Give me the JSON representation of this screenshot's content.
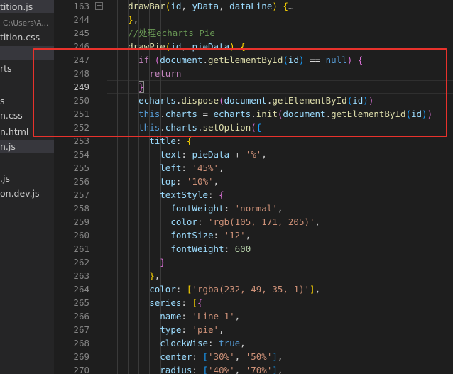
{
  "sidebar": {
    "files": [
      {
        "name": "tition.js",
        "active": true
      },
      {
        "name": "C:\\Users\\A...",
        "active": false,
        "sub": true
      },
      {
        "name": "tition.css",
        "active": false
      },
      {
        "name": "",
        "active": true
      },
      {
        "name": "rts",
        "active": false
      },
      {
        "name": "",
        "active": false
      },
      {
        "name": "s",
        "active": false
      },
      {
        "name": "n.css",
        "active": false
      },
      {
        "name": "n.html",
        "active": false
      },
      {
        "name": "n.js",
        "active": true
      },
      {
        "name": "",
        "active": false
      },
      {
        "name": ".js",
        "active": false
      },
      {
        "name": "on.dev.js",
        "active": false
      }
    ]
  },
  "gutter": {
    "line_numbers": [
      "163",
      "244",
      "245",
      "246",
      "247",
      "248",
      "249",
      "250",
      "251",
      "252",
      "253",
      "254",
      "255",
      "256",
      "257",
      "258",
      "259",
      "260",
      "261",
      "262",
      "263",
      "264",
      "265",
      "266",
      "267",
      "268",
      "269",
      "270"
    ],
    "current_line": "249",
    "fold_symbol": "+"
  },
  "code": {
    "lines": [
      {
        "indent": 2,
        "tokens": [
          [
            "fn",
            "drawBar"
          ],
          [
            "b1",
            "("
          ],
          [
            "vr",
            "id"
          ],
          [
            "pn",
            ", "
          ],
          [
            "vr",
            "yData"
          ],
          [
            "pn",
            ", "
          ],
          [
            "vr",
            "dataLine"
          ],
          [
            "b1",
            ")"
          ],
          [
            "pn",
            " "
          ],
          [
            "b1",
            "{"
          ],
          [
            "fold-dots",
            "…"
          ]
        ]
      },
      {
        "indent": 2,
        "tokens": [
          [
            "b1",
            "}"
          ],
          [
            "pn",
            ","
          ]
        ]
      },
      {
        "indent": 2,
        "tokens": [
          [
            "cm",
            "//处理echarts Pie"
          ]
        ]
      },
      {
        "indent": 2,
        "tokens": [
          [
            "fn",
            "drawPie"
          ],
          [
            "b1",
            "("
          ],
          [
            "vr",
            "id"
          ],
          [
            "pn",
            ", "
          ],
          [
            "vr",
            "pieData"
          ],
          [
            "b1",
            ")"
          ],
          [
            "pn",
            " "
          ],
          [
            "b1",
            "{"
          ]
        ]
      },
      {
        "indent": 3,
        "tokens": [
          [
            "kw",
            "if"
          ],
          [
            "pn",
            " "
          ],
          [
            "b2",
            "("
          ],
          [
            "vr",
            "document"
          ],
          [
            "pn",
            "."
          ],
          [
            "fn",
            "getElementById"
          ],
          [
            "b3",
            "("
          ],
          [
            "vr",
            "id"
          ],
          [
            "b3",
            ")"
          ],
          [
            "pn",
            " == "
          ],
          [
            "kb",
            "null"
          ],
          [
            "b2",
            ")"
          ],
          [
            "pn",
            " "
          ],
          [
            "b2",
            "{"
          ]
        ]
      },
      {
        "indent": 4,
        "tokens": [
          [
            "kw",
            "return"
          ]
        ]
      },
      {
        "indent": 3,
        "tokens": [
          [
            "b2",
            "}"
          ]
        ]
      },
      {
        "indent": 3,
        "tokens": [
          [
            "vr",
            "echarts"
          ],
          [
            "pn",
            "."
          ],
          [
            "fn",
            "dispose"
          ],
          [
            "b2",
            "("
          ],
          [
            "vr",
            "document"
          ],
          [
            "pn",
            "."
          ],
          [
            "fn",
            "getElementById"
          ],
          [
            "b3",
            "("
          ],
          [
            "vr",
            "id"
          ],
          [
            "b3",
            ")"
          ],
          [
            "b2",
            ")"
          ]
        ]
      },
      {
        "indent": 3,
        "tokens": [
          [
            "kb",
            "this"
          ],
          [
            "pn",
            "."
          ],
          [
            "vr",
            "charts"
          ],
          [
            "pn",
            " = "
          ],
          [
            "vr",
            "echarts"
          ],
          [
            "pn",
            "."
          ],
          [
            "fn",
            "init"
          ],
          [
            "b2",
            "("
          ],
          [
            "vr",
            "document"
          ],
          [
            "pn",
            "."
          ],
          [
            "fn",
            "getElementById"
          ],
          [
            "b3",
            "("
          ],
          [
            "vr",
            "id"
          ],
          [
            "b3",
            ")"
          ],
          [
            "b2",
            ")"
          ]
        ]
      },
      {
        "indent": 3,
        "tokens": [
          [
            "kb",
            "this"
          ],
          [
            "pn",
            "."
          ],
          [
            "vr",
            "charts"
          ],
          [
            "pn",
            "."
          ],
          [
            "fn",
            "setOption"
          ],
          [
            "b2",
            "("
          ],
          [
            "b3",
            "{"
          ]
        ]
      },
      {
        "indent": 4,
        "tokens": [
          [
            "vr",
            "title"
          ],
          [
            "pn",
            ": "
          ],
          [
            "b1",
            "{"
          ]
        ]
      },
      {
        "indent": 5,
        "tokens": [
          [
            "vr",
            "text"
          ],
          [
            "pn",
            ": "
          ],
          [
            "vr",
            "pieData"
          ],
          [
            "pn",
            " + "
          ],
          [
            "st",
            "'%'"
          ],
          [
            "pn",
            ","
          ]
        ]
      },
      {
        "indent": 5,
        "tokens": [
          [
            "vr",
            "left"
          ],
          [
            "pn",
            ": "
          ],
          [
            "st",
            "'45%'"
          ],
          [
            "pn",
            ","
          ]
        ]
      },
      {
        "indent": 5,
        "tokens": [
          [
            "vr",
            "top"
          ],
          [
            "pn",
            ": "
          ],
          [
            "st",
            "'10%'"
          ],
          [
            "pn",
            ","
          ]
        ]
      },
      {
        "indent": 5,
        "tokens": [
          [
            "vr",
            "textStyle"
          ],
          [
            "pn",
            ": "
          ],
          [
            "b2",
            "{"
          ]
        ]
      },
      {
        "indent": 6,
        "tokens": [
          [
            "vr",
            "fontWeight"
          ],
          [
            "pn",
            ": "
          ],
          [
            "st",
            "'normal'"
          ],
          [
            "pn",
            ","
          ]
        ]
      },
      {
        "indent": 6,
        "tokens": [
          [
            "vr",
            "color"
          ],
          [
            "pn",
            ": "
          ],
          [
            "st",
            "'rgb(105, 171, 205)'"
          ],
          [
            "pn",
            ","
          ]
        ]
      },
      {
        "indent": 6,
        "tokens": [
          [
            "vr",
            "fontSize"
          ],
          [
            "pn",
            ": "
          ],
          [
            "st",
            "'12'"
          ],
          [
            "pn",
            ","
          ]
        ]
      },
      {
        "indent": 6,
        "tokens": [
          [
            "vr",
            "fontWeight"
          ],
          [
            "pn",
            ": "
          ],
          [
            "nm",
            "600"
          ]
        ]
      },
      {
        "indent": 5,
        "tokens": [
          [
            "b2",
            "}"
          ]
        ]
      },
      {
        "indent": 4,
        "tokens": [
          [
            "b1",
            "}"
          ],
          [
            "pn",
            ","
          ]
        ]
      },
      {
        "indent": 4,
        "tokens": [
          [
            "vr",
            "color"
          ],
          [
            "pn",
            ": "
          ],
          [
            "b1",
            "["
          ],
          [
            "st",
            "'rgba(232, 49, 35, 1)'"
          ],
          [
            "b1",
            "]"
          ],
          [
            "pn",
            ","
          ]
        ]
      },
      {
        "indent": 4,
        "tokens": [
          [
            "vr",
            "series"
          ],
          [
            "pn",
            ": "
          ],
          [
            "b1",
            "["
          ],
          [
            "b2",
            "{"
          ]
        ]
      },
      {
        "indent": 5,
        "tokens": [
          [
            "vr",
            "name"
          ],
          [
            "pn",
            ": "
          ],
          [
            "st",
            "'Line 1'"
          ],
          [
            "pn",
            ","
          ]
        ]
      },
      {
        "indent": 5,
        "tokens": [
          [
            "vr",
            "type"
          ],
          [
            "pn",
            ": "
          ],
          [
            "st",
            "'pie'"
          ],
          [
            "pn",
            ","
          ]
        ]
      },
      {
        "indent": 5,
        "tokens": [
          [
            "vr",
            "clockWise"
          ],
          [
            "pn",
            ": "
          ],
          [
            "kb",
            "true"
          ],
          [
            "pn",
            ","
          ]
        ]
      },
      {
        "indent": 5,
        "tokens": [
          [
            "vr",
            "center"
          ],
          [
            "pn",
            ": "
          ],
          [
            "b3",
            "["
          ],
          [
            "st",
            "'30%'"
          ],
          [
            "pn",
            ", "
          ],
          [
            "st",
            "'50%'"
          ],
          [
            "b3",
            "]"
          ],
          [
            "pn",
            ","
          ]
        ]
      },
      {
        "indent": 5,
        "tokens": [
          [
            "vr",
            "radius"
          ],
          [
            "pn",
            ": "
          ],
          [
            "b3",
            "["
          ],
          [
            "st",
            "'40%'"
          ],
          [
            "pn",
            ", "
          ],
          [
            "st",
            "'70%'"
          ],
          [
            "b3",
            "]"
          ],
          [
            "pn",
            ","
          ]
        ]
      }
    ]
  },
  "colors": {
    "highlight_box": "#e8322c",
    "editor_bg": "#1e1e1e",
    "sidebar_bg": "#252526"
  }
}
